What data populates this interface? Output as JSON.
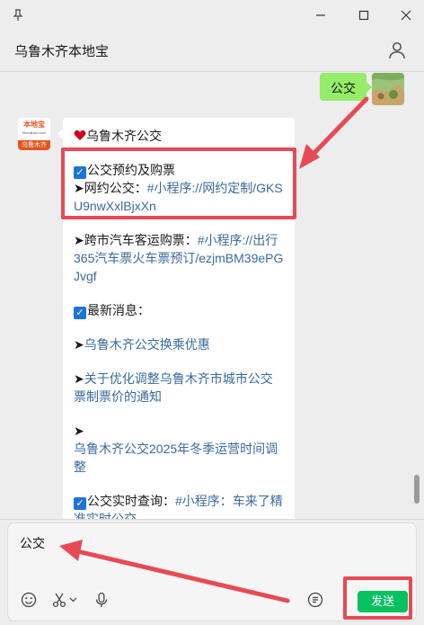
{
  "window": {
    "pin_icon": "pin-icon",
    "minimize_icon": "minimize-icon",
    "maximize_icon": "maximize-icon",
    "close_icon": "close-icon"
  },
  "header": {
    "title": "乌鲁木齐本地宝",
    "profile_icon": "person-icon"
  },
  "messages": {
    "sent": {
      "text": "公交"
    },
    "received": {
      "avatar_brand": "本地宝",
      "avatar_site": "Bendibao.com",
      "avatar_city": "乌鲁木齐",
      "lines": {
        "title": "乌鲁木齐公交",
        "booking_heading": "公交预约及购票",
        "ride_hailing_prefix": "➤网约公交：",
        "ride_hailing_link": "#小程序://网约定制/GKSU9nwXxlBjxXn",
        "intercity_prefix": "➤跨市汽车客运购票：",
        "intercity_link": "#小程序://出行365汽车票火车票预订/ezjmBM39ePGJvgf",
        "news_heading": "最新消息：",
        "news_1": "乌鲁木齐公交换乘优惠",
        "news_2": "关于优化调整乌鲁木齐市城市公交票制票价的通知",
        "news_3_arrow": "➤",
        "news_3": "乌鲁木齐公交2025年冬季运营时间调整",
        "realtime_prefix": "公交实时查询：",
        "realtime_link": "#小程序：车来了精准实时公交"
      }
    }
  },
  "composer": {
    "input_value": "公交",
    "send_label": "发送"
  },
  "colors": {
    "accent": "#07c160",
    "sent_bubble": "#95ec69",
    "annotation": "#e84a55",
    "link": "#3a6a9e"
  }
}
